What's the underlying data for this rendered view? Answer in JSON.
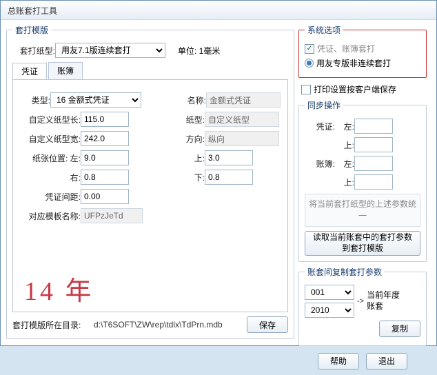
{
  "window": {
    "title": "总账套打工具"
  },
  "template": {
    "legend": "套打模版",
    "paper_type_label": "套打纸型:",
    "paper_type_value": "用友7.1版连续套打",
    "unit_label": "单位: 1毫米",
    "tabs": {
      "voucher": "凭证",
      "ledger": "账簿"
    },
    "type_label": "类型:",
    "type_value": "16 金额式凭证",
    "name_label": "名称:",
    "name_value": "金额式凭证",
    "custom_len_label": "自定义纸型长:",
    "custom_len_value": "115.0",
    "inner_paper_label": "纸型:",
    "inner_paper_value": "自定义纸型",
    "custom_wid_label": "自定义纸型宽:",
    "custom_wid_value": "242.0",
    "direction_label": "方向:",
    "direction_value": "纵向",
    "pos_left_label": "纸张位置: 左:",
    "pos_left_value": "9.0",
    "pos_top_label": "上:",
    "pos_top_value": "3.0",
    "pos_right_label": "右:",
    "pos_right_value": "0.8",
    "pos_bottom_label": "下:",
    "pos_bottom_value": "0.8",
    "gap_label": "凭证间距:",
    "gap_value": "0.00",
    "tpl_name_label": "对应模板名称:",
    "tpl_name_value": "UFPzJeTd",
    "annotation": "14 年",
    "path_label": "套打模版所在目录:",
    "path_value": "d:\\T6SOFT\\ZW\\rep\\tdlx\\TdPrn.mdb",
    "save_btn": "保存"
  },
  "system": {
    "legend": "系统选项",
    "opt1": "凭证、账簿套打",
    "opt2": "用友专版非连续套打",
    "opt3": "打印设置按客户端保存"
  },
  "sync": {
    "legend": "同步操作",
    "voucher_label": "凭证:",
    "left_label": "左:",
    "top_label": "上:",
    "ledger_label": "账簿:",
    "note": "将当前套打纸型的上述参数统一",
    "read_btn": "读取当前账套中的套打参数到套打模版"
  },
  "copy": {
    "legend": "账套间复制套打参数",
    "src": "001",
    "dst": "2010",
    "arrow": "->",
    "note": "当前年度账套",
    "copy_btn": "复制"
  },
  "footer": {
    "help": "帮助",
    "exit": "退出"
  }
}
